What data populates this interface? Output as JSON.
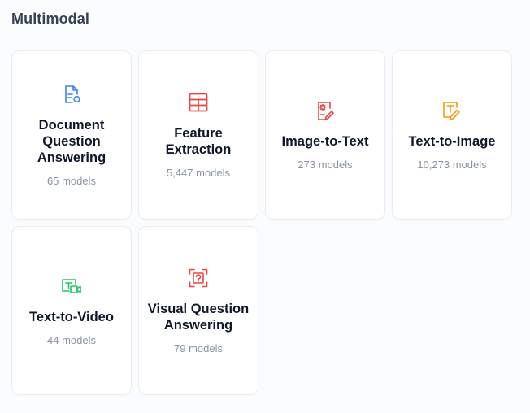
{
  "section": {
    "title": "Multimodal"
  },
  "cards": [
    {
      "name": "Document Question Answering",
      "count": "65 models",
      "icon": "document-search-icon",
      "color": "#3b82f6"
    },
    {
      "name": "Feature Extraction",
      "count": "5,447 models",
      "icon": "table-grid-icon",
      "color": "#ef4444"
    },
    {
      "name": "Image-to-Text",
      "count": "273 models",
      "icon": "image-to-text-icon",
      "color": "#ef4444"
    },
    {
      "name": "Text-to-Image",
      "count": "10,273 models",
      "icon": "text-to-image-icon",
      "color": "#f59e0b"
    },
    {
      "name": "Text-to-Video",
      "count": "44 models",
      "icon": "text-to-video-icon",
      "color": "#22c55e"
    },
    {
      "name": "Visual Question Answering",
      "count": "79 models",
      "icon": "visual-qa-icon",
      "color": "#ef4444"
    }
  ]
}
